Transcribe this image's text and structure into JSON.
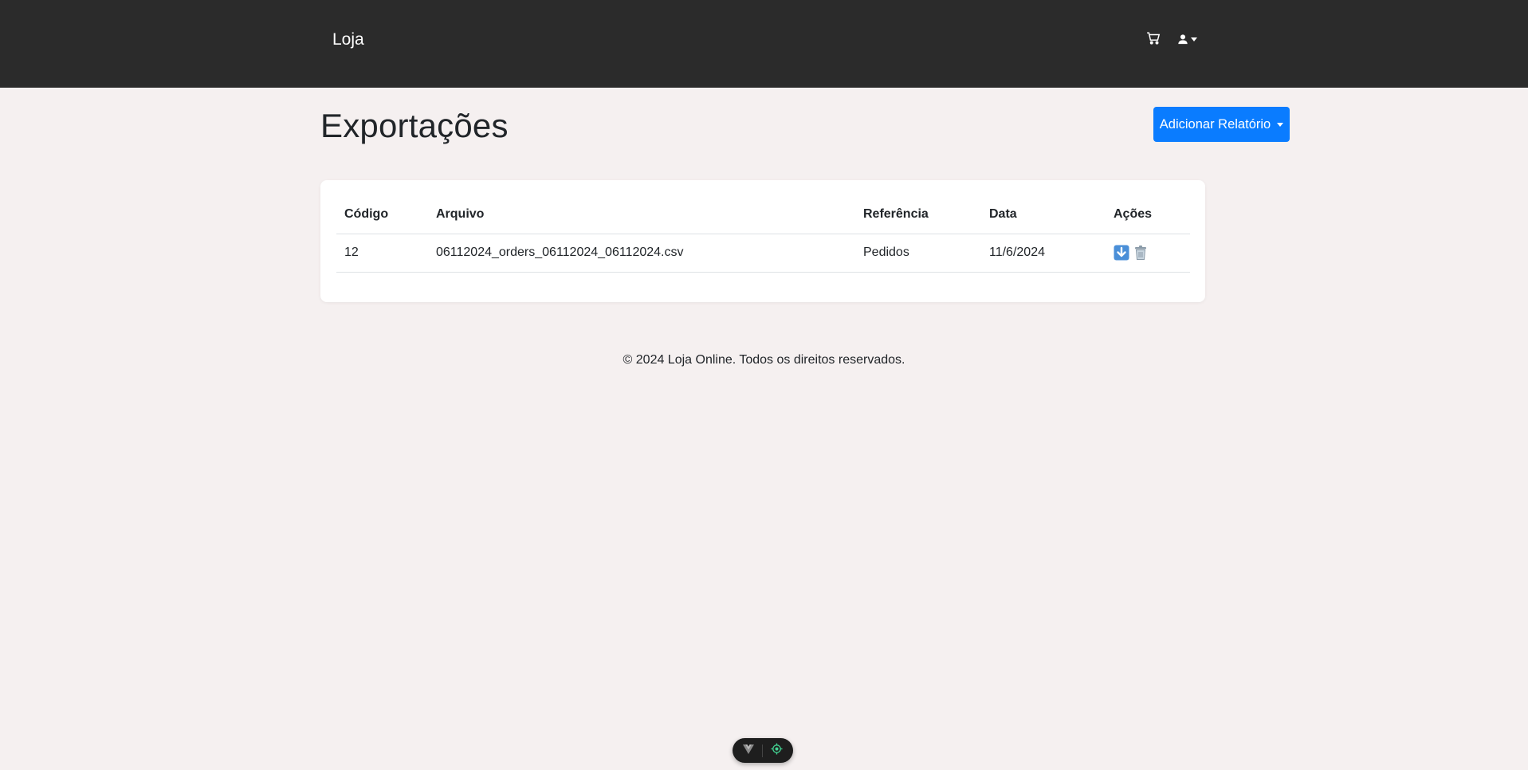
{
  "nav": {
    "brand": "Loja",
    "icons": [
      "cart-icon",
      "user-icon"
    ]
  },
  "page": {
    "title": "Exportações",
    "add_button": "Adicionar Relatório"
  },
  "table": {
    "headers": [
      "Código",
      "Arquivo",
      "Referência",
      "Data",
      "Ações"
    ],
    "rows": [
      {
        "codigo": "12",
        "arquivo": "06112024_orders_06112024_06112024.csv",
        "referencia": "Pedidos",
        "data": "11/6/2024",
        "actions": [
          "download-icon",
          "trash-icon"
        ]
      }
    ]
  },
  "footer": {
    "text": "© 2024 Loja Online. Todos os direitos reservados."
  },
  "colors": {
    "navbar": "#2b2b2b",
    "background": "#f5f0f0",
    "primary": "#0a7cff",
    "devtools_accent": "#42d392"
  }
}
